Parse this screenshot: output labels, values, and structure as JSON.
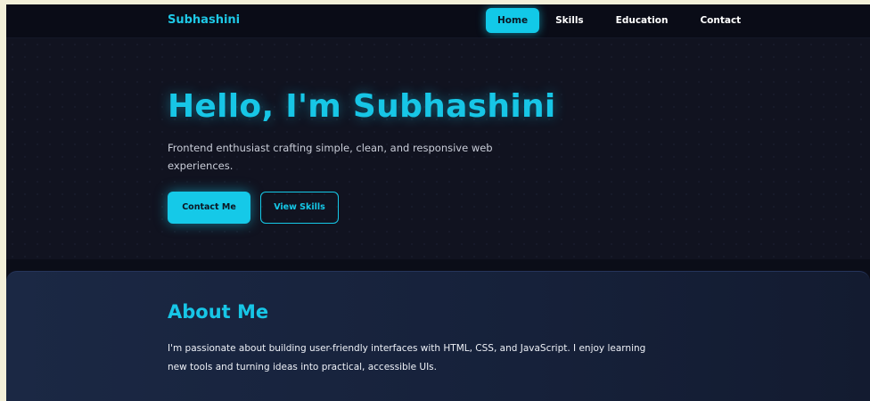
{
  "nav": {
    "brand": "Subhashini",
    "links": [
      "Home",
      "Skills",
      "Education",
      "Contact"
    ],
    "active": "Home"
  },
  "hero": {
    "title": "Hello, I'm Subhashini",
    "subtitle": "Frontend enthusiast crafting simple, clean, and responsive web experiences.",
    "primary_button": "Contact Me",
    "secondary_button": "View Skills"
  },
  "about": {
    "title": "About Me",
    "text": "I'm passionate about building user-friendly interfaces with HTML, CSS, and JavaScript. I enjoy learning new tools and turning ideas into practical, accessible UIs."
  },
  "colors": {
    "accent": "#15c9e8",
    "background": "#0b0d18",
    "about_background": "#1b2844"
  }
}
